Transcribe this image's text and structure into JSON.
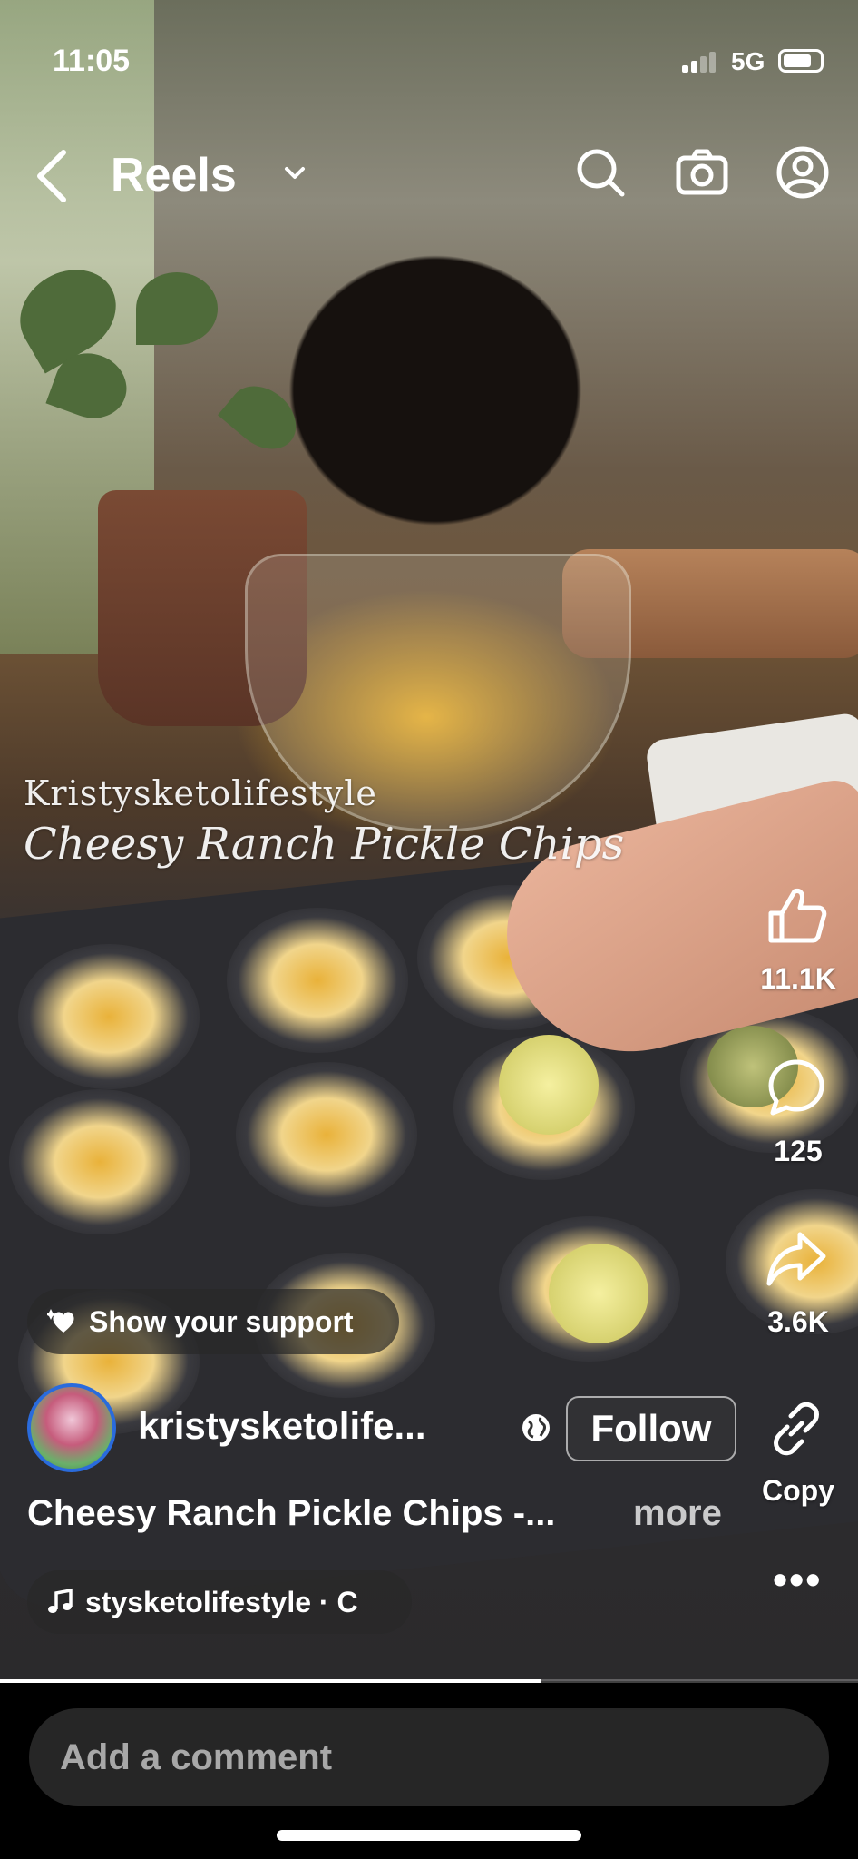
{
  "status_bar": {
    "time": "11:05",
    "network": "5G"
  },
  "header": {
    "title": "Reels"
  },
  "video_overlay": {
    "line1": "Kristysketolifestyle",
    "line2": "Cheesy Ranch Pickle Chips"
  },
  "actions": {
    "likes": "11.1K",
    "comments": "125",
    "shares": "3.6K",
    "copy_label": "Copy"
  },
  "support": {
    "label": "Show your support"
  },
  "account": {
    "username": "kristysketolife..."
  },
  "follow": {
    "label": "Follow"
  },
  "caption": {
    "text": "Cheesy Ranch Pickle Chips -...",
    "more": "more"
  },
  "audio": {
    "label": "stysketolifestyle · C"
  },
  "progress": {
    "played_fraction": 0.63
  },
  "comment": {
    "placeholder": "Add a comment"
  },
  "colors": {
    "avatar_ring": "#2a6bdc",
    "comment_bg": "#262626"
  }
}
